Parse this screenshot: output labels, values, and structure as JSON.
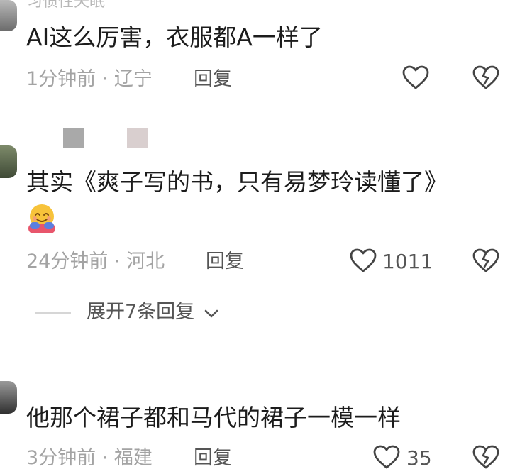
{
  "top_cut_text": "习惯性失眠",
  "comments": [
    {
      "text": "AI这么厉害，衣服都A一样了",
      "time_location": "1分钟前 · 辽宁",
      "reply_label": "回复",
      "likes": ""
    },
    {
      "text": "其实《爽子写的书，只有易梦玲读懂了》",
      "emoji": "hugging-face-emoji",
      "time_location": "24分钟前 · 河北",
      "reply_label": "回复",
      "likes": "1011",
      "expand_label": "展开7条回复"
    },
    {
      "text": "他那个裙子都和马代的裙子一模一样",
      "time_location": "3分钟前 · 福建",
      "reply_label": "回复",
      "likes": "35"
    }
  ],
  "colors": {
    "text": "#1c1c1c",
    "meta": "#a3a3a3",
    "secondary": "#555555",
    "background": "#ffffff"
  }
}
